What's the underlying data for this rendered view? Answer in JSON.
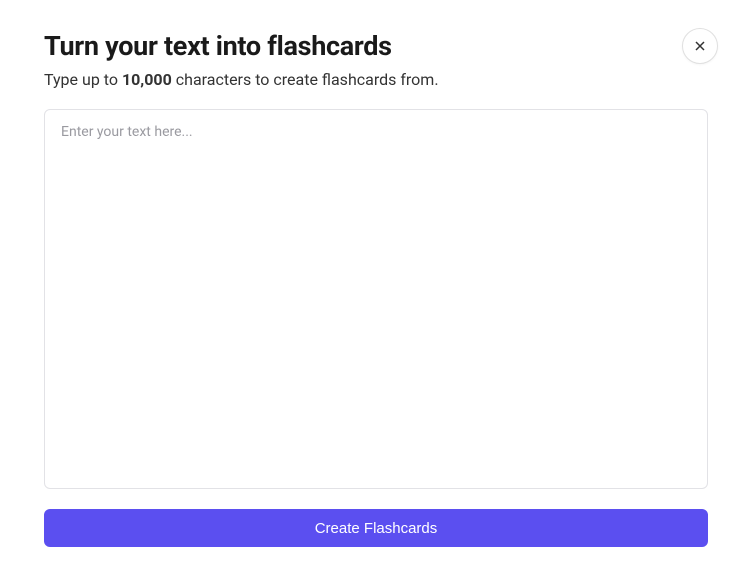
{
  "header": {
    "title": "Turn your text into flashcards",
    "subtitle_prefix": "Type up to ",
    "char_limit": "10,000",
    "subtitle_suffix": " characters to create flashcards from."
  },
  "input": {
    "placeholder": "Enter your text here...",
    "value": ""
  },
  "actions": {
    "create_label": "Create Flashcards"
  },
  "icons": {
    "close": "close-icon"
  }
}
